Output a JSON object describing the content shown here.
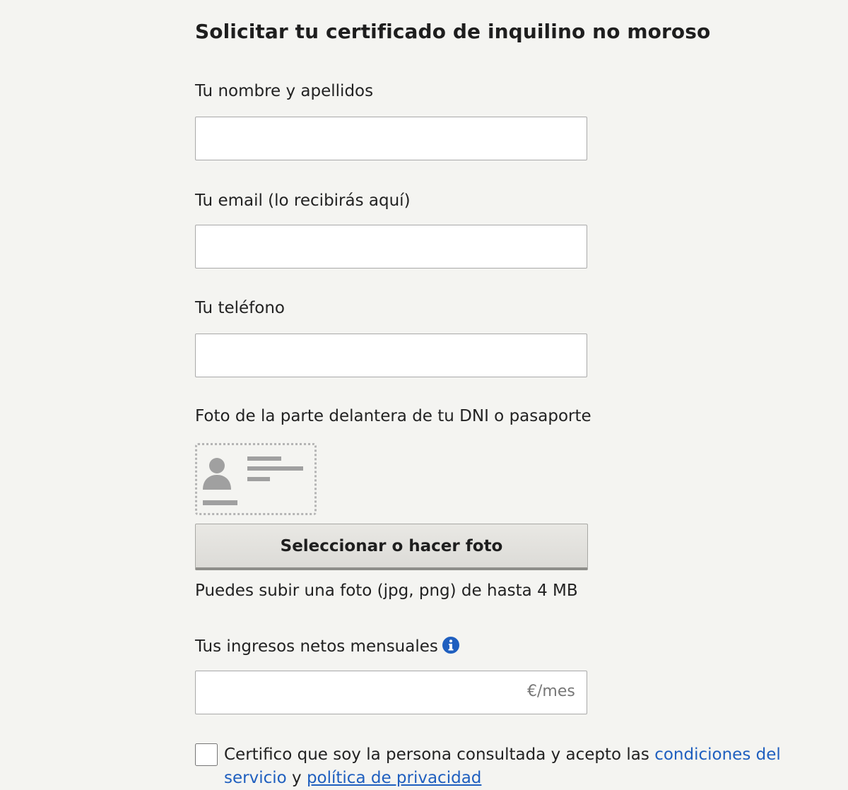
{
  "form": {
    "title": "Solicitar tu certificado de inquilino no moroso",
    "name": {
      "label": "Tu nombre y apellidos",
      "value": ""
    },
    "email": {
      "label": "Tu email (lo recibirás aquí)",
      "value": ""
    },
    "phone": {
      "label": "Tu teléfono",
      "value": ""
    },
    "id_photo": {
      "label": "Foto de la parte delantera de tu DNI o pasaporte",
      "placeholder_icon": "id-card-icon",
      "button_label": "Seleccionar o hacer foto",
      "hint": "Puedes subir una foto (jpg, png) de hasta 4 MB"
    },
    "income": {
      "label": "Tus ingresos netos mensuales",
      "info_icon": "info-icon",
      "suffix": "€/mes",
      "value": ""
    },
    "consent": {
      "checked": false,
      "text_before": "Certifico que soy la persona consultada y acepto las ",
      "terms_link": "condiciones del servicio",
      "text_between": " y ",
      "privacy_link": "política de privacidad"
    }
  },
  "colors": {
    "background": "#f4f4f1",
    "link": "#1f5fbf",
    "info_icon": "#1f5fbf",
    "field_border": "#a9a9a9",
    "placeholder_art": "#a0a0a0"
  }
}
